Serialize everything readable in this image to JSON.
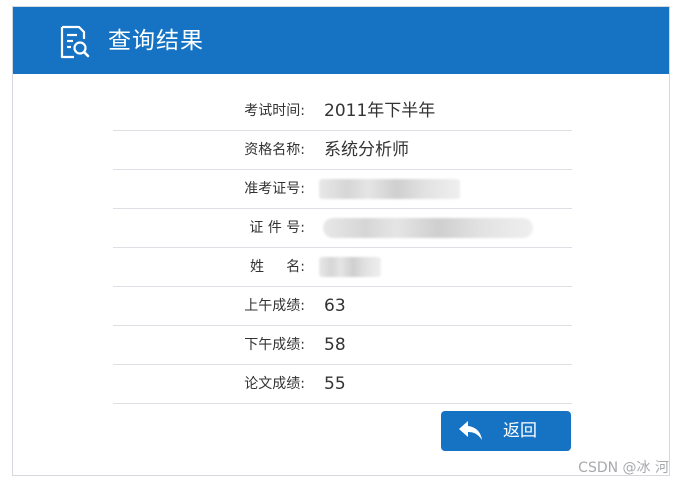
{
  "header": {
    "title": "查询结果",
    "icon": "document-search-icon",
    "color": "#1673c4"
  },
  "results": {
    "rows": [
      {
        "label": "考试时间:",
        "value": "2011年下半年"
      },
      {
        "label": "资格名称:",
        "value": "系统分析师"
      },
      {
        "label": "准考证号:",
        "value": ""
      },
      {
        "label": "证 件 号:",
        "value": ""
      },
      {
        "label": "姓     名:",
        "value": ""
      },
      {
        "label": "上午成绩:",
        "value": "63"
      },
      {
        "label": "下午成绩:",
        "value": "58"
      },
      {
        "label": "论文成绩:",
        "value": "55"
      }
    ]
  },
  "actions": {
    "return_label": "返回",
    "return_icon": "reply-arrow-icon"
  },
  "watermark": "CSDN @冰 河"
}
